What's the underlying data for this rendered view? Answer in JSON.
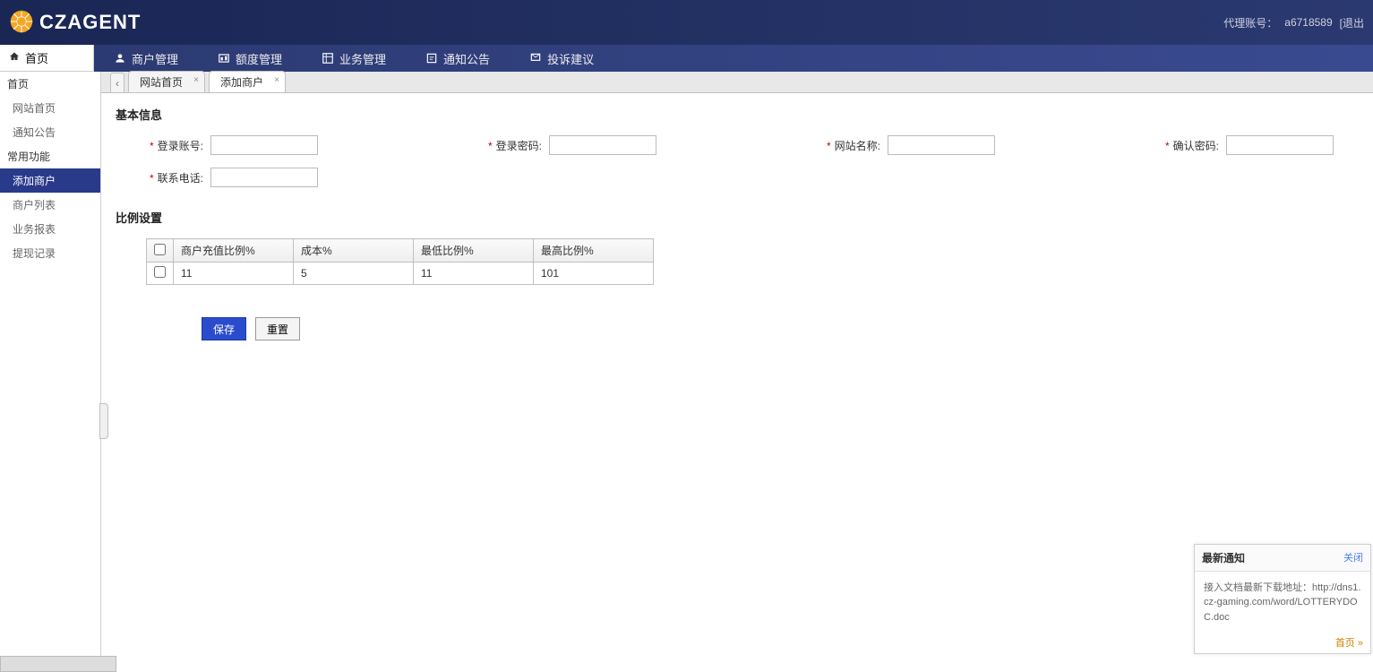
{
  "brand": "CZAGENT",
  "header_right": {
    "agent_label": "代理账号：",
    "agent_value": "a6718589",
    "logout": "[退出"
  },
  "topnav": {
    "home": "首页",
    "items": [
      {
        "label": "商户管理"
      },
      {
        "label": "额度管理"
      },
      {
        "label": "业务管理"
      },
      {
        "label": "通知公告"
      },
      {
        "label": "投诉建议"
      }
    ]
  },
  "sidebar": {
    "group1": "首页",
    "g1_items": [
      "网站首页",
      "通知公告"
    ],
    "group2": "常用功能",
    "g2_items": [
      "添加商户",
      "商户列表",
      "业务报表",
      "提现记录"
    ],
    "active_index": 0
  },
  "tabs": [
    {
      "label": "网站首页"
    },
    {
      "label": "添加商户"
    }
  ],
  "active_tab": 1,
  "section1_title": "基本信息",
  "form": {
    "f1": {
      "label": "登录账号:"
    },
    "f2": {
      "label": "登录密码:"
    },
    "f3": {
      "label": "网站名称:"
    },
    "f4": {
      "label": "确认密码:"
    },
    "f5": {
      "label": "联系电话:"
    }
  },
  "section2_title": "比例设置",
  "table": {
    "headers": [
      "商户充值比例%",
      "成本%",
      "最低比例%",
      "最高比例%"
    ],
    "row": [
      "11",
      "5",
      "11",
      "101"
    ]
  },
  "buttons": {
    "save": "保存",
    "reset": "重置"
  },
  "notif": {
    "title": "最新通知",
    "close": "关闭",
    "body": "接入文档最新下载地址：http://dns1.cz-gaming.com/word/LOTTERYDOC.doc",
    "more": "首页 »"
  }
}
